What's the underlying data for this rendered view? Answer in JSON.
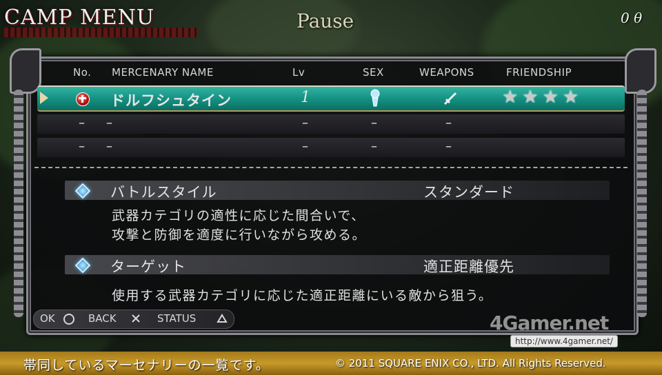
{
  "header": {
    "logo": "CAMP MENU",
    "pause": "Pause",
    "gold": "0 θ"
  },
  "table": {
    "headers": {
      "no": "No.",
      "name": "MERCENARY NAME",
      "lv": "Lv",
      "sex": "SEX",
      "weapons": "WEAPONS",
      "friendship": "FRIENDSHIP"
    },
    "rows": [
      {
        "name": "ドルフシュタイン",
        "lv": "1",
        "sex_icon": "female-icon",
        "weapon_icon": "sword-icon",
        "friendship": "★★★★",
        "friendship_stars": 4,
        "selected": true
      },
      {
        "no": "–",
        "name": "–",
        "lv": "–",
        "sex": "–",
        "weapons": "–"
      },
      {
        "no": "–",
        "name": "–",
        "lv": "–",
        "sex": "–",
        "weapons": "–"
      }
    ]
  },
  "details": [
    {
      "label": "バトルスタイル",
      "value": "スタンダード",
      "desc_line1": "武器カテゴリの適性に応じた間合いで、",
      "desc_line2": "攻撃と防御を適度に行いながら攻める。"
    },
    {
      "label": "ターゲット",
      "value": "適正距離優先",
      "desc_line1": "使用する武器カテゴリに応じた適正距離にいる敵から狙う。"
    }
  ],
  "controls": {
    "ok": "OK",
    "back": "BACK",
    "status": "STATUS"
  },
  "watermark": {
    "brand": "4Gamer.net",
    "url": "http://www.4gamer.net/"
  },
  "footer": {
    "help": "帯同しているマーセナリーの一覧です。",
    "copyright": "© 2011 SQUARE ENIX CO., LTD. All Rights Reserved."
  },
  "colors": {
    "selected_row": "#149283",
    "footer_bar": "#c89a2a",
    "diamond": "#3a9fd8"
  }
}
